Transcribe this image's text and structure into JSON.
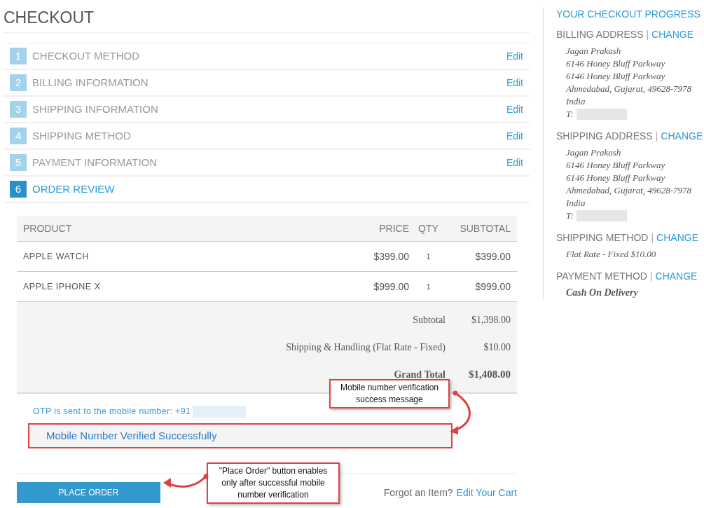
{
  "title": "CHECKOUT",
  "steps": [
    {
      "number": "1",
      "label": "CHECKOUT METHOD",
      "edit": "Edit",
      "selected": false
    },
    {
      "number": "2",
      "label": "BILLING INFORMATION",
      "edit": "Edit",
      "selected": false
    },
    {
      "number": "3",
      "label": "SHIPPING INFORMATION",
      "edit": "Edit",
      "selected": false
    },
    {
      "number": "4",
      "label": "SHIPPING METHOD",
      "edit": "Edit",
      "selected": false
    },
    {
      "number": "5",
      "label": "PAYMENT INFORMATION",
      "edit": "Edit",
      "selected": false
    },
    {
      "number": "6",
      "label": "ORDER REVIEW",
      "selected": true
    }
  ],
  "table": {
    "columns": [
      "PRODUCT",
      "PRICE",
      "QTY",
      "SUBTOTAL"
    ],
    "rows": [
      {
        "product": "APPLE WATCH",
        "price": "$399.00",
        "qty": "1",
        "subtotal": "$399.00"
      },
      {
        "product": "APPLE IPHONE X",
        "price": "$999.00",
        "qty": "1",
        "subtotal": "$999.00"
      }
    ],
    "totals": [
      {
        "label": "Subtotal",
        "value": "$1,398.00",
        "bold": false
      },
      {
        "label": "Shipping & Handling (Flat Rate - Fixed)",
        "value": "$10.00",
        "bold": false
      },
      {
        "label": "Grand Total",
        "value": "$1,408.00",
        "bold": true
      }
    ]
  },
  "otp_message": "OTP is sent to the mobile number: +91",
  "verified_message": "Mobile Number Verified Successfully",
  "place_order_button": "PLACE ORDER",
  "forgot_text": "Forgot an Item?",
  "edit_cart_link": "Edit Your Cart",
  "annotations": [
    {
      "text": "Mobile number verification success message",
      "kind": "verified"
    },
    {
      "text": "\"Place Order\" button enables only after successful mobile number verification",
      "kind": "button"
    }
  ],
  "sidebar": {
    "title": "YOUR CHECKOUT PROGRESS",
    "sections": [
      {
        "heading": "BILLING ADDRESS",
        "separator": "|",
        "change": "CHANGE",
        "lines": [
          "Jagan Prakash",
          "6146 Honey Bluff Parkway",
          "6146 Honey Bluff Parkway",
          "Ahmedabad, Gujarat, 49628-7978",
          "India"
        ],
        "phone_label": "T:",
        "bold": false
      },
      {
        "heading": "SHIPPING ADDRESS",
        "separator": "|",
        "change": "CHANGE",
        "lines": [
          "Jagan Prakash",
          "6146 Honey Bluff Parkway",
          "6146 Honey Bluff Parkway",
          "Ahmedabad, Gujarat, 49628-7978",
          "India"
        ],
        "phone_label": "T:",
        "bold": false
      },
      {
        "heading": "SHIPPING METHOD",
        "separator": "|",
        "change": "CHANGE",
        "lines": [
          "Flat Rate - Fixed $10.00"
        ],
        "bold": false
      },
      {
        "heading": "PAYMENT METHOD",
        "separator": "|",
        "change": "CHANGE",
        "lines": [
          "Cash On Delivery"
        ],
        "bold": true
      }
    ]
  }
}
